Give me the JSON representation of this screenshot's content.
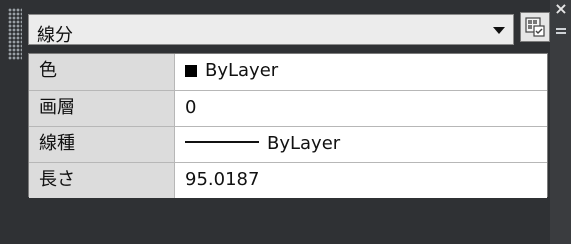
{
  "selector": {
    "value": "線分"
  },
  "properties": [
    {
      "label": "色",
      "value": "ByLayer",
      "kind": "color",
      "swatch_color": "#000000"
    },
    {
      "label": "画層",
      "value": "0",
      "kind": "text"
    },
    {
      "label": "線種",
      "value": "ByLayer",
      "kind": "linetype"
    },
    {
      "label": "長さ",
      "value": "95.0187",
      "kind": "text"
    }
  ],
  "icons": {
    "close": "close-icon",
    "menu": "menu-icon",
    "quick_select": "quick-select-icon",
    "grip": "grip-icon",
    "dropdown": "chevron-down-icon"
  },
  "colors": {
    "background": "#2f3134",
    "label_cell": "#dcdcdc",
    "value_cell": "#ffffff",
    "border": "#7b7b7b"
  }
}
